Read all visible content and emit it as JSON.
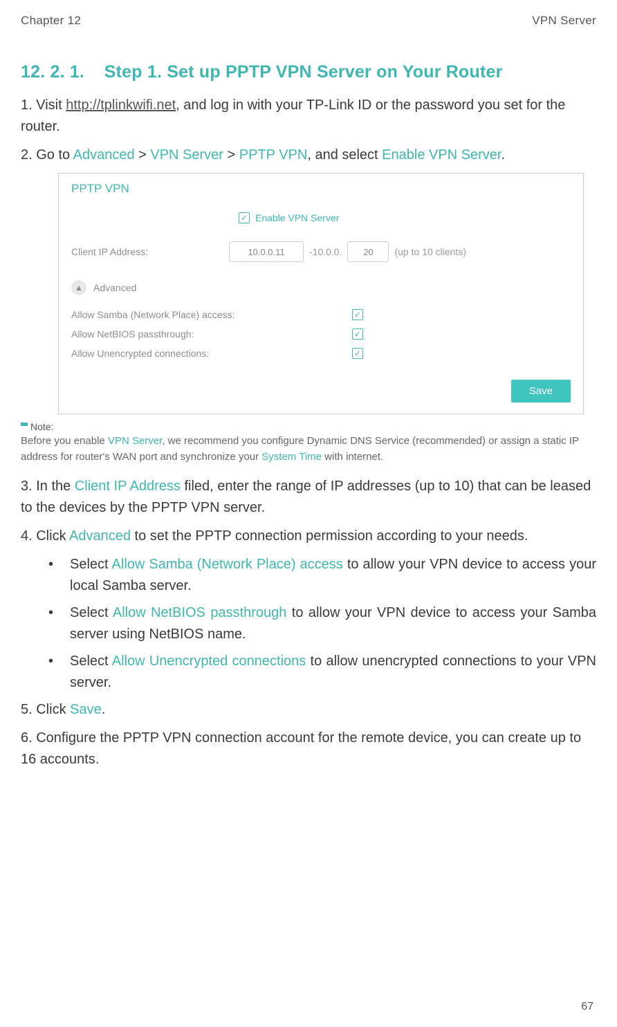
{
  "header": {
    "chapter": "Chapter 12",
    "section": "VPN Server"
  },
  "heading": {
    "number": "12. 2. 1.",
    "title": "Step 1. Set up PPTP VPN Server on Your Router"
  },
  "step1": {
    "prefix": "1. Visit ",
    "link": "http://tplinkwifi.net",
    "suffix": ", and log in with your TP-Link ID or the password you set for the router."
  },
  "step2": {
    "prefix": "2. Go to ",
    "nav1": "Advanced",
    "sep1": " > ",
    "nav2": "VPN Server",
    "sep2": " > ",
    "nav3": "PPTP VPN",
    "mid": ", and select ",
    "nav4": "Enable VPN Server",
    "end": "."
  },
  "ui": {
    "title": "PPTP VPN",
    "enable_label": "Enable VPN Server",
    "client_ip_label": "Client IP Address:",
    "ip_start": "10.0.0.11",
    "ip_range_prefix": "-10.0.0.",
    "ip_end": "20",
    "ip_hint": "(up to 10 clients)",
    "advanced": "Advanced",
    "opt_samba": "Allow Samba (Network Place) access:",
    "opt_netbios": "Allow NetBIOS passthrough:",
    "opt_unenc": "Allow Unencrypted connections:",
    "save": "Save"
  },
  "note": {
    "title": "Note:",
    "p1": "Before you enable ",
    "vpn": "VPN Server",
    "p2": ", we recommend you configure Dynamic DNS Service (recommended) or assign a static IP address for router's WAN port and synchronize your ",
    "st": "System Time",
    "p3": " with internet."
  },
  "step3": {
    "prefix": "3. In the ",
    "hl": "Client IP Address",
    "suffix": " filed, enter the range of IP addresses (up to 10) that can be leased to the devices by the PPTP VPN server."
  },
  "step4": {
    "prefix": "4. Click ",
    "hl": "Advanced",
    "suffix": " to set the PPTP connection permission according to your needs."
  },
  "bullets": [
    {
      "p1": "Select ",
      "hl": "Allow Samba (Network Place) access",
      "p2": " to allow your VPN device to access your local Samba server."
    },
    {
      "p1": "Select ",
      "hl": "Allow NetBIOS passthrough",
      "p2": " to allow your VPN device to access your Samba server using NetBIOS name."
    },
    {
      "p1": "Select ",
      "hl": "Allow Unencrypted connections",
      "p2": " to allow unencrypted connections to your VPN server."
    }
  ],
  "step5": {
    "prefix": "5. Click ",
    "hl": "Save",
    "suffix": "."
  },
  "step6": "6. Configure the PPTP VPN connection account for the remote device, you can create up to 16 accounts.",
  "page": "67"
}
